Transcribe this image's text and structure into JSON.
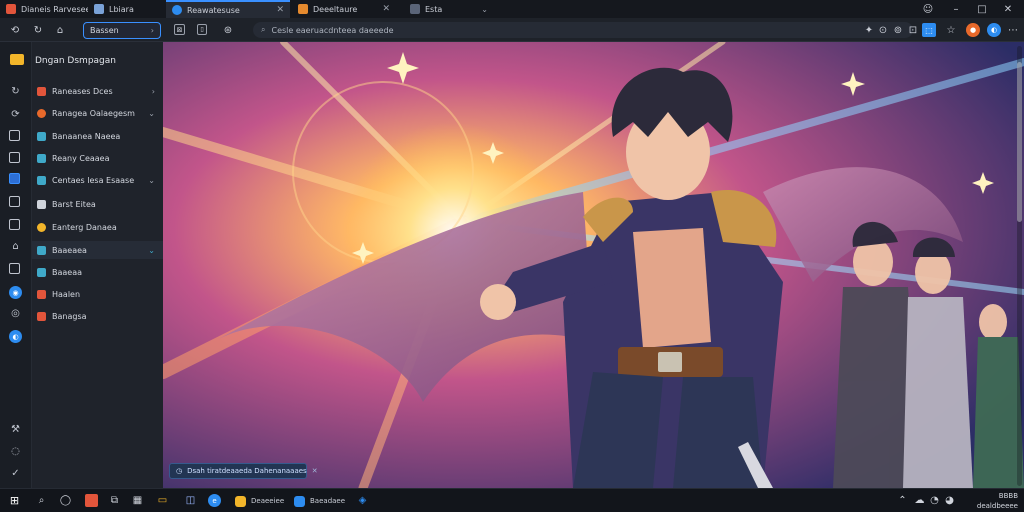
{
  "window": {
    "tabs": [
      {
        "label": "Dianeis Rarvesee",
        "color": "#e2553b"
      },
      {
        "label": "Lbiara",
        "color": "#7aa2d8"
      },
      {
        "label": "Reawatesuse",
        "color": "#2d8cf0",
        "active": true
      },
      {
        "label": "Deeeltaure",
        "color": "#e68a2e"
      },
      {
        "label": "Esta",
        "color": "#5a6478"
      }
    ],
    "controls": {
      "minimize": "–",
      "maximize": "□",
      "close": "✕"
    }
  },
  "toolbar": {
    "search_value": "Bassen",
    "address": "Cesle eaeruacdnteea daeeede",
    "icons": [
      "back-icon",
      "refresh-icon",
      "home-icon",
      "bookmark-icon",
      "share-icon",
      "extensions-icon",
      "profile-icon",
      "menu-icon"
    ]
  },
  "sidebar": {
    "title": "Dngan Dsmpagan",
    "items": [
      {
        "label": "Raneases Dces",
        "color": "#e2553b",
        "expandable": true
      },
      {
        "label": "Ranagea Oalaegesm",
        "color": "#e8692b",
        "round": true,
        "expandable": true,
        "accent": "#e2553b"
      },
      {
        "label": "Banaanea Naeea",
        "color": "#3fa9c9",
        "accent": "#e2553b"
      },
      {
        "label": "Reany Ceaaea",
        "color": "#3fa9c9"
      },
      {
        "label": "Centaes lesa Esaase",
        "color": "#3fa9c9",
        "expandable": true
      },
      {
        "label": "Barst Eitea",
        "color": "#d0d4dc"
      },
      {
        "label": "Eanterg Danaea",
        "color": "#f2b52a",
        "round": true
      },
      {
        "label": "Baaeaea",
        "color": "#3fa9c9",
        "expandable": true,
        "selected": true
      },
      {
        "label": "Baaeaa",
        "color": "#3fa9c9"
      },
      {
        "label": "Haalen",
        "color": "#e2553b"
      },
      {
        "label": "Banagsa",
        "color": "#e2553b"
      }
    ]
  },
  "content": {
    "toast": "Dsah tiratdeaaeda Dahenanaaaes"
  },
  "taskbar": {
    "apps": [
      {
        "label": "Deaeeiee",
        "color": "#f2b52a"
      },
      {
        "label": "Baeadaee",
        "color": "#2d8cf0"
      }
    ],
    "clock_time": "BBBB",
    "clock_date": "dealdbeeee"
  }
}
